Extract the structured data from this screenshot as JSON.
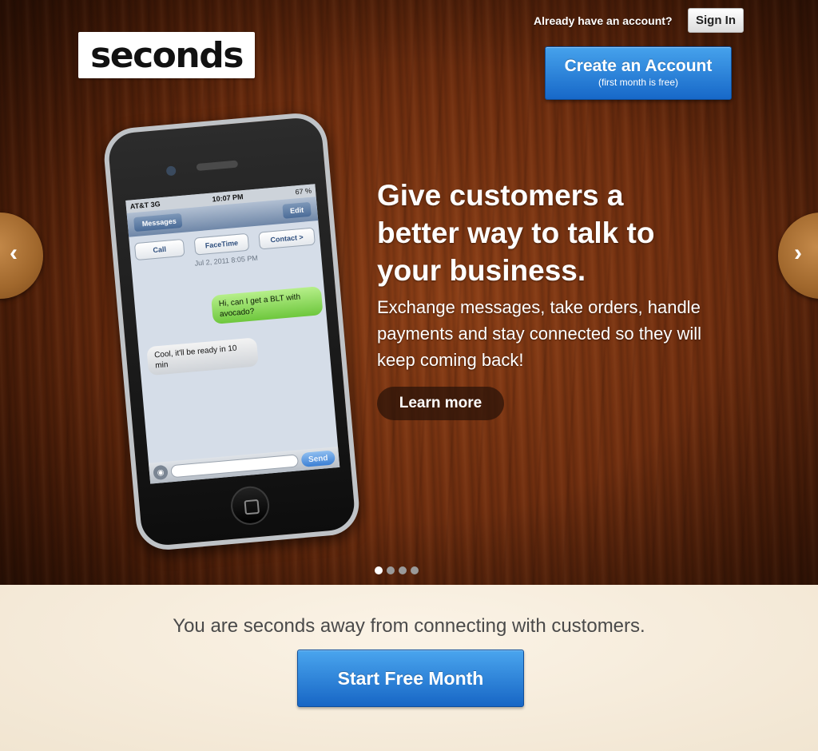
{
  "brand": {
    "logo_text": "seconds"
  },
  "header": {
    "account_prompt": "Already have an account?",
    "sign_in_label": "Sign In",
    "create_account_label": "Create an Account",
    "create_account_sub": "(first month is free)"
  },
  "carousel": {
    "prev_icon": "‹",
    "next_icon": "›",
    "headline": "Give customers a better way to talk to your business.",
    "subtext": "Exchange messages, take orders, handle payments and stay connected so they will keep coming back!",
    "learn_more_label": "Learn more",
    "slide_count": 4,
    "active_slide": 1
  },
  "phone": {
    "carrier": "AT&T 3G",
    "time": "10:07 PM",
    "battery": "67 %",
    "nav_back": "Messages",
    "nav_edit": "Edit",
    "actions": [
      "Call",
      "FaceTime",
      "Contact >"
    ],
    "date": "Jul 2, 2011 8:05 PM",
    "messages": [
      {
        "direction": "out",
        "text": "Hi, can I get a BLT with avocado?"
      },
      {
        "direction": "in",
        "text": "Cool, it'll be ready in 10 min"
      }
    ],
    "send_label": "Send"
  },
  "cta": {
    "tagline": "You are seconds away from connecting with customers.",
    "start_label": "Start Free Month"
  },
  "colors": {
    "wood": "#6f2e0f",
    "button_blue": "#1768c8",
    "cta_background": "#f4ead9"
  }
}
